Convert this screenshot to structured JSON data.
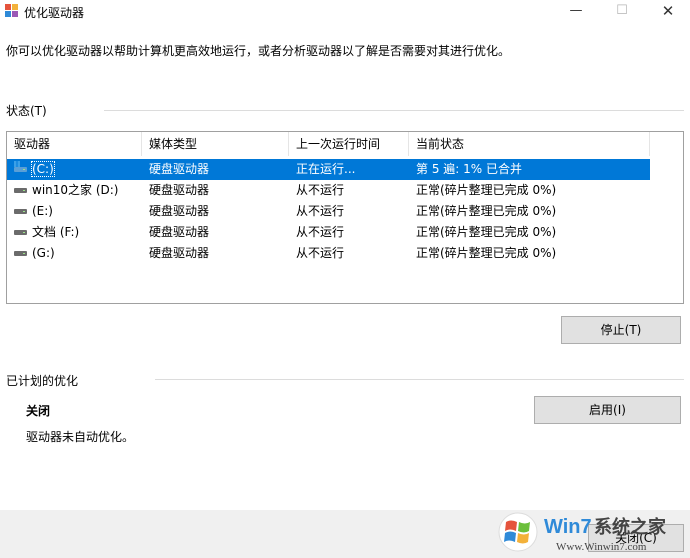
{
  "window": {
    "title": "优化驱动器",
    "minimize_glyph": "—",
    "maximize_glyph": "☐",
    "close_glyph": "✕",
    "icon": "defrag-app-icon"
  },
  "description": "你可以优化驱动器以帮助计算机更高效地运行，或者分析驱动器以了解是否需要对其进行优化。",
  "status_section": {
    "label": "状态(T)"
  },
  "table": {
    "columns": [
      "驱动器",
      "媒体类型",
      "上一次运行时间",
      "当前状态"
    ],
    "rows": [
      {
        "drive": "(C:)",
        "media": "硬盘驱动器",
        "last_run": "正在运行...",
        "status": "第 5 遍: 1% 已合并",
        "selected": true,
        "icon": "system-drive-icon"
      },
      {
        "drive": "win10之家 (D:)",
        "media": "硬盘驱动器",
        "last_run": "从不运行",
        "status": "正常(碎片整理已完成 0%)",
        "selected": false,
        "icon": "hard-drive-icon"
      },
      {
        "drive": "(E:)",
        "media": "硬盘驱动器",
        "last_run": "从不运行",
        "status": "正常(碎片整理已完成 0%)",
        "selected": false,
        "icon": "hard-drive-icon"
      },
      {
        "drive": "文档 (F:)",
        "media": "硬盘驱动器",
        "last_run": "从不运行",
        "status": "正常(碎片整理已完成 0%)",
        "selected": false,
        "icon": "hard-drive-icon"
      },
      {
        "drive": "(G:)",
        "media": "硬盘驱动器",
        "last_run": "从不运行",
        "status": "正常(碎片整理已完成 0%)",
        "selected": false,
        "icon": "hard-drive-icon"
      }
    ]
  },
  "buttons": {
    "stop": "停止(T)",
    "enable": "启用(I)",
    "close": "关闭(C)"
  },
  "scheduled_section": {
    "label": "已计划的优化",
    "state": "关闭",
    "detail": "驱动器未自动优化。"
  },
  "watermark": {
    "brand": "Win7系统之家",
    "url": "Www.Winwin7.com"
  },
  "colors": {
    "selection": "#0078d7",
    "footer_bg": "#f0f0f0",
    "button_bg": "#e1e1e1"
  }
}
